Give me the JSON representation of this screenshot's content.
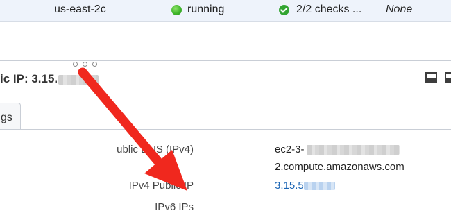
{
  "instance_row": {
    "availability_zone": "us-east-2c",
    "instance_state": "running",
    "status_checks": "2/2 checks ...",
    "key_name": "None"
  },
  "detail_header": {
    "public_ip_label": "ic IP: 3.15."
  },
  "tabs": [
    {
      "label": "gs"
    }
  ],
  "description": {
    "public_dns_label": "ublic DNS (IPv4)",
    "public_dns_line1": "ec2-3-",
    "public_dns_line2": "2.compute.amazonaws.com",
    "ipv4_public_ip_label": "IPv4 Public IP",
    "ipv4_public_ip_value": "3.15.5",
    "ipv6_ips_label": "IPv6 IPs"
  },
  "colors": {
    "row_highlight": "#eef3fb",
    "running_green": "#3fb62a",
    "check_green": "#33a532",
    "link_blue": "#1a64b4",
    "annotation_red": "#f0281e"
  },
  "icons": [
    "running-status-icon",
    "check-circle-icon",
    "drag-handle-icon",
    "panel-layout-icon",
    "annotation-arrow"
  ]
}
